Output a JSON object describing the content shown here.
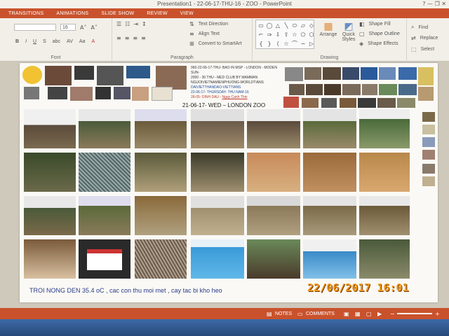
{
  "window": {
    "title": "Presentation1 - 22-06-17-THU-16 - ZOO - PowerPoint",
    "controls": "?  —  ❐  ✕"
  },
  "ribbon_tabs": [
    "TRANSITIONS",
    "ANIMATIONS",
    "SLIDE SHOW",
    "REVIEW",
    "VIEW"
  ],
  "ribbon": {
    "font": {
      "label": "Font",
      "font_size": "16",
      "grow": "A˄",
      "shrink": "A˅",
      "bold": "B",
      "italic": "I",
      "underline": "U",
      "strike": "S",
      "shadow": "abc",
      "spacing": "AV",
      "case": "Aa",
      "color": "A"
    },
    "paragraph": {
      "label": "Paragraph",
      "text_direction": "Text Direction",
      "align_text": "Align Text",
      "convert_smartart": "Convert to SmartArt"
    },
    "drawing": {
      "label": "Drawing",
      "arrange": "Arrange",
      "quick_styles": "Quick Styles",
      "shape_fill": "Shape Fill",
      "shape_outline": "Shape Outline",
      "shape_effects": "Shape Effects"
    },
    "editing": {
      "label": "Editing",
      "find": "Find",
      "replace": "Replace",
      "select": "Select"
    }
  },
  "slide": {
    "header_text_lines": [
      "060-22-06-17-THU- BAO IN MSP - LONDON - MODEN SUN-",
      "2000 - 30 THU - MED CLUB BY MAMMAN",
      "NGUOIVIETNAMIENPHUONG-WORLDTIANS",
      "DAIVIETTHANDAO-VIETTIANS",
      "22-06-17- THURSDAY- THU NAM-16",
      "28-05- DINH DAU -"
    ],
    "header_link": "Ngay Canh Thin",
    "date_title": "21-06-17- WED – LONDON ZOO",
    "caption": "TROI NONG DEN 35.4 oC , cac con thu moi met , cay tac bi kho heo"
  },
  "camera_timestamp": "22/06/2017  16:01",
  "statusbar": {
    "notes": "NOTES",
    "comments": "COMMENTS"
  },
  "colors": {
    "accent": "#c9522c",
    "timestamp": "#f29a1a",
    "caption": "#2a3a8a",
    "link": "#c0392b"
  }
}
